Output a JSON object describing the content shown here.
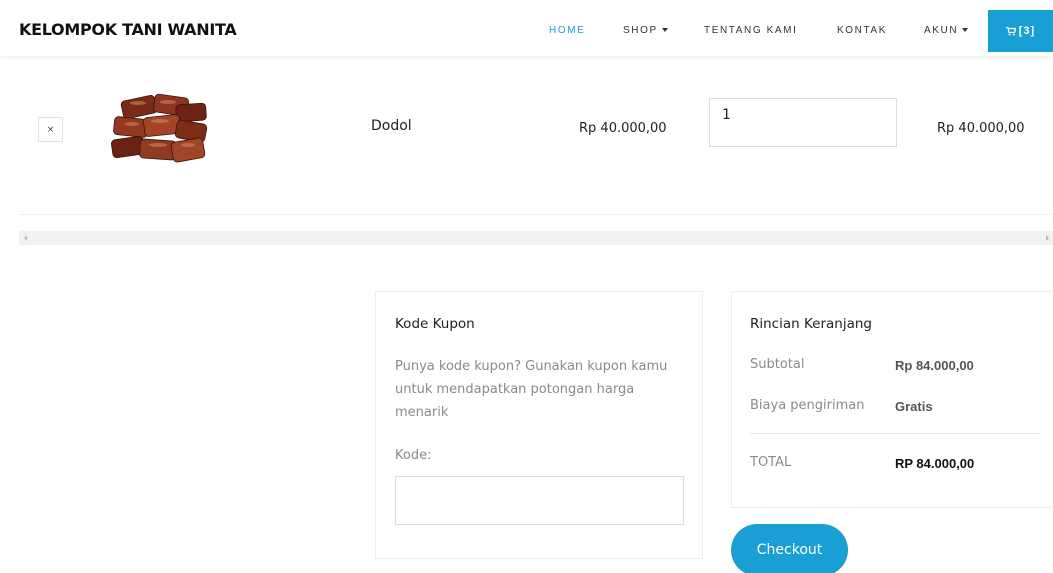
{
  "navbar": {
    "brand": "KELOMPOK TANI WANITA",
    "items": [
      {
        "label": "HOME",
        "active": true
      },
      {
        "label": "SHOP",
        "dropdown": true
      },
      {
        "label": "TENTANG KAMI"
      },
      {
        "label": "KONTAK"
      },
      {
        "label": "AKUN",
        "dropdown": true
      }
    ],
    "cart_label": "[3]",
    "cart_icon": "cart-icon"
  },
  "cart": {
    "remove_label": "×",
    "items": [
      {
        "name": "Dodol",
        "price": "Rp 40.000,00",
        "quantity": "1",
        "total": "Rp 40.000,00",
        "image": "dodol-product-image"
      }
    ]
  },
  "coupon": {
    "title": "Kode Kupon",
    "description": "Punya kode kupon? Gunakan kupon kamu untuk mendapatkan potongan harga menarik",
    "code_label": "Kode:",
    "code_value": ""
  },
  "totals": {
    "title": "Rincian Keranjang",
    "subtotal_label": "Subtotal",
    "subtotal_value": "Rp 84.000,00",
    "shipping_label": "Biaya pengiriman",
    "shipping_value": "Gratis",
    "total_label": "TOTAL",
    "total_value": "RP 84.000,00"
  },
  "checkout_label": "Checkout",
  "colors": {
    "accent": "#1a9fd4",
    "muted_text": "#8a8a8a"
  }
}
